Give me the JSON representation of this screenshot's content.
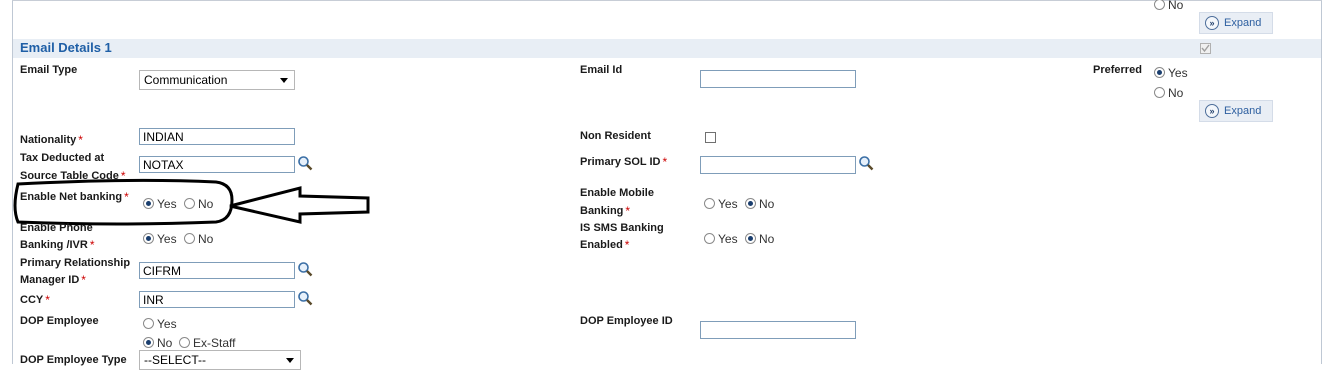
{
  "top_partial": {
    "no_label": "No",
    "expand_label": "Expand"
  },
  "section": {
    "title": "Email Details 1"
  },
  "email_type": {
    "label": "Email Type",
    "value": "Communication"
  },
  "email_id": {
    "label": "Email Id"
  },
  "preferred": {
    "label": "Preferred",
    "yes": "Yes",
    "no": "No",
    "selected": "Yes",
    "expand_label": "Expand"
  },
  "nationality": {
    "label": "Nationality",
    "value": "INDIAN"
  },
  "non_resident": {
    "label": "Non Resident"
  },
  "tds": {
    "label_line1": "Tax Deducted at",
    "label_line2": "Source Table Code",
    "value": "NOTAX"
  },
  "primary_sol": {
    "label": "Primary SOL ID",
    "value": ""
  },
  "net_banking": {
    "label": "Enable Net banking",
    "yes": "Yes",
    "no": "No",
    "selected": "Yes"
  },
  "mobile_banking": {
    "label_line1": "Enable Mobile",
    "label_line2": "Banking",
    "yes": "Yes",
    "no": "No",
    "selected": "No"
  },
  "phone_banking": {
    "label_line1": "Enable Phone",
    "label_line2": "Banking /IVR",
    "yes": "Yes",
    "no": "No",
    "selected": "Yes"
  },
  "sms_banking": {
    "label_line1": "IS SMS Banking",
    "label_line2": "Enabled",
    "yes": "Yes",
    "no": "No",
    "selected": "No"
  },
  "rm_id": {
    "label_line1": "Primary Relationship",
    "label_line2": "Manager ID",
    "value": "CIFRM"
  },
  "ccy": {
    "label": "CCY",
    "value": "INR"
  },
  "dop_employee": {
    "label": "DOP Employee",
    "opt_yes": "Yes",
    "opt_no": "No",
    "opt_exstaff": "Ex-Staff",
    "selected": "No"
  },
  "dop_employee_id": {
    "label": "DOP Employee ID",
    "value": ""
  },
  "dop_employee_type": {
    "label": "DOP Employee Type",
    "value": "--SELECT--"
  },
  "required_mark": "*",
  "colors": {
    "section_title": "#1f5fa6",
    "section_bar": "#e8eef5",
    "required": "#cc0000"
  }
}
